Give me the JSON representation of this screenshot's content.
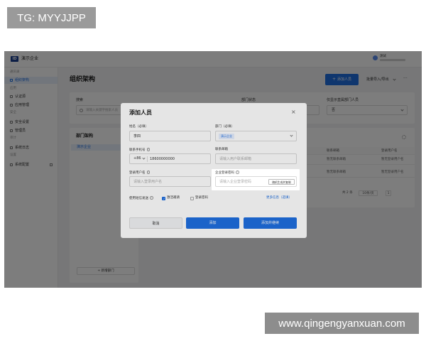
{
  "colors": {
    "accent": "#1f6fe0"
  },
  "watermarks": {
    "top_left": "TG: MYYJJPP",
    "bottom_right": "www.qingengyanxuan.com"
  },
  "header": {
    "logo": "ID",
    "company": "演示企业",
    "user": "测试"
  },
  "sidebar": {
    "groups": [
      {
        "heading": "通讯录",
        "items": [
          {
            "label": "组织架构",
            "icon": "org-icon",
            "active": true
          }
        ]
      },
      {
        "heading": "应用",
        "items": [
          {
            "label": "认证源",
            "icon": "key-icon"
          },
          {
            "label": "应用管理",
            "icon": "app-icon"
          }
        ]
      },
      {
        "heading": "安全",
        "items": [
          {
            "label": "安全设置",
            "icon": "shield-icon"
          },
          {
            "label": "管理员",
            "icon": "user-icon"
          }
        ]
      },
      {
        "heading": "审计",
        "items": [
          {
            "label": "系统日志",
            "icon": "log-icon"
          }
        ]
      },
      {
        "heading": "设置",
        "items": [
          {
            "label": "系统配置",
            "icon": "settings-icon",
            "trailing_icon": "external-link-icon"
          }
        ]
      }
    ]
  },
  "main": {
    "title": "组织架构",
    "add_person": "添加人员",
    "bulk": "批量导入/导出",
    "filters": {
      "search_label": "搜索",
      "search_placeholder": "请输入关键字搜索人员",
      "status_label": "部门状态",
      "direct_label": "仅显示直属部门人员",
      "direct_value": "否"
    },
    "dept_panel": {
      "title": "部门架构",
      "root": "演示企业",
      "add_dept": "新增部门"
    },
    "table": {
      "columns": [
        "联系邮箱",
        "登录用户名"
      ],
      "rows": [
        [
          "暂无联系邮箱",
          "暂无登录用户名"
        ],
        [
          "暂无联系邮箱",
          "暂无登录用户名"
        ]
      ],
      "total": "共 2 条",
      "page_size": "10条/页",
      "page": "1"
    }
  },
  "modal": {
    "title": "添加人员",
    "name": {
      "label": "姓名（必填）",
      "value": "李四"
    },
    "dept": {
      "label": "部门（必填）",
      "tag": "演示企业"
    },
    "phone": {
      "label": "联系手机号",
      "code": "+86",
      "value": "18600000000"
    },
    "email": {
      "label": "联系邮箱",
      "placeholder": "请输入用户联系邮箱"
    },
    "username": {
      "label": "登录用户名",
      "placeholder": "请输入登录用户名"
    },
    "password": {
      "label": "企业登录密码",
      "placeholder": "请输入企业登录密码",
      "generate": "随机生成并复制"
    },
    "sms": {
      "label": "使用短信发送",
      "options": [
        {
          "label": "激活邀请",
          "checked": true
        },
        {
          "label": "登录密码",
          "checked": false
        }
      ]
    },
    "more_info": "更多信息（选填）",
    "buttons": {
      "cancel": "取消",
      "add": "添加",
      "add_continue": "添加并继续"
    }
  }
}
